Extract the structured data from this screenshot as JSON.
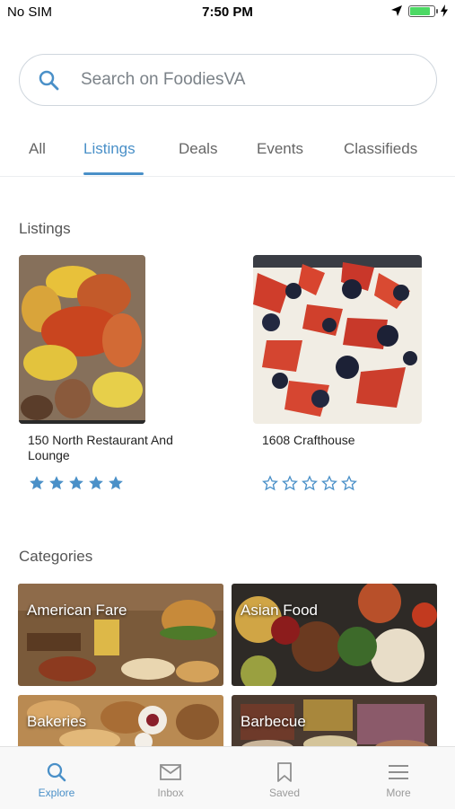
{
  "status_bar": {
    "carrier": "No SIM",
    "time": "7:50 PM"
  },
  "search": {
    "placeholder": "Search on FoodiesVA"
  },
  "tabs": [
    {
      "label": "All",
      "active": false
    },
    {
      "label": "Listings",
      "active": true
    },
    {
      "label": "Deals",
      "active": false
    },
    {
      "label": "Events",
      "active": false
    },
    {
      "label": "Classifieds",
      "active": false
    }
  ],
  "listings_section": {
    "title": "Listings",
    "items": [
      {
        "name": "150 North Restaurant And Lounge",
        "rating": 5
      },
      {
        "name": "1608 Crafthouse",
        "rating": 0
      }
    ]
  },
  "categories_section": {
    "title": "Categories",
    "items": [
      {
        "label": "American Fare"
      },
      {
        "label": "Asian Food"
      },
      {
        "label": "Bakeries"
      },
      {
        "label": "Barbecue"
      }
    ]
  },
  "tab_bar": [
    {
      "label": "Explore",
      "icon": "search-icon",
      "active": true
    },
    {
      "label": "Inbox",
      "icon": "mail-icon",
      "active": false
    },
    {
      "label": "Saved",
      "icon": "bookmark-icon",
      "active": false
    },
    {
      "label": "More",
      "icon": "menu-icon",
      "active": false
    }
  ],
  "colors": {
    "accent": "#4a90c8",
    "star": "#4a90c8",
    "battery": "#4cd964"
  }
}
